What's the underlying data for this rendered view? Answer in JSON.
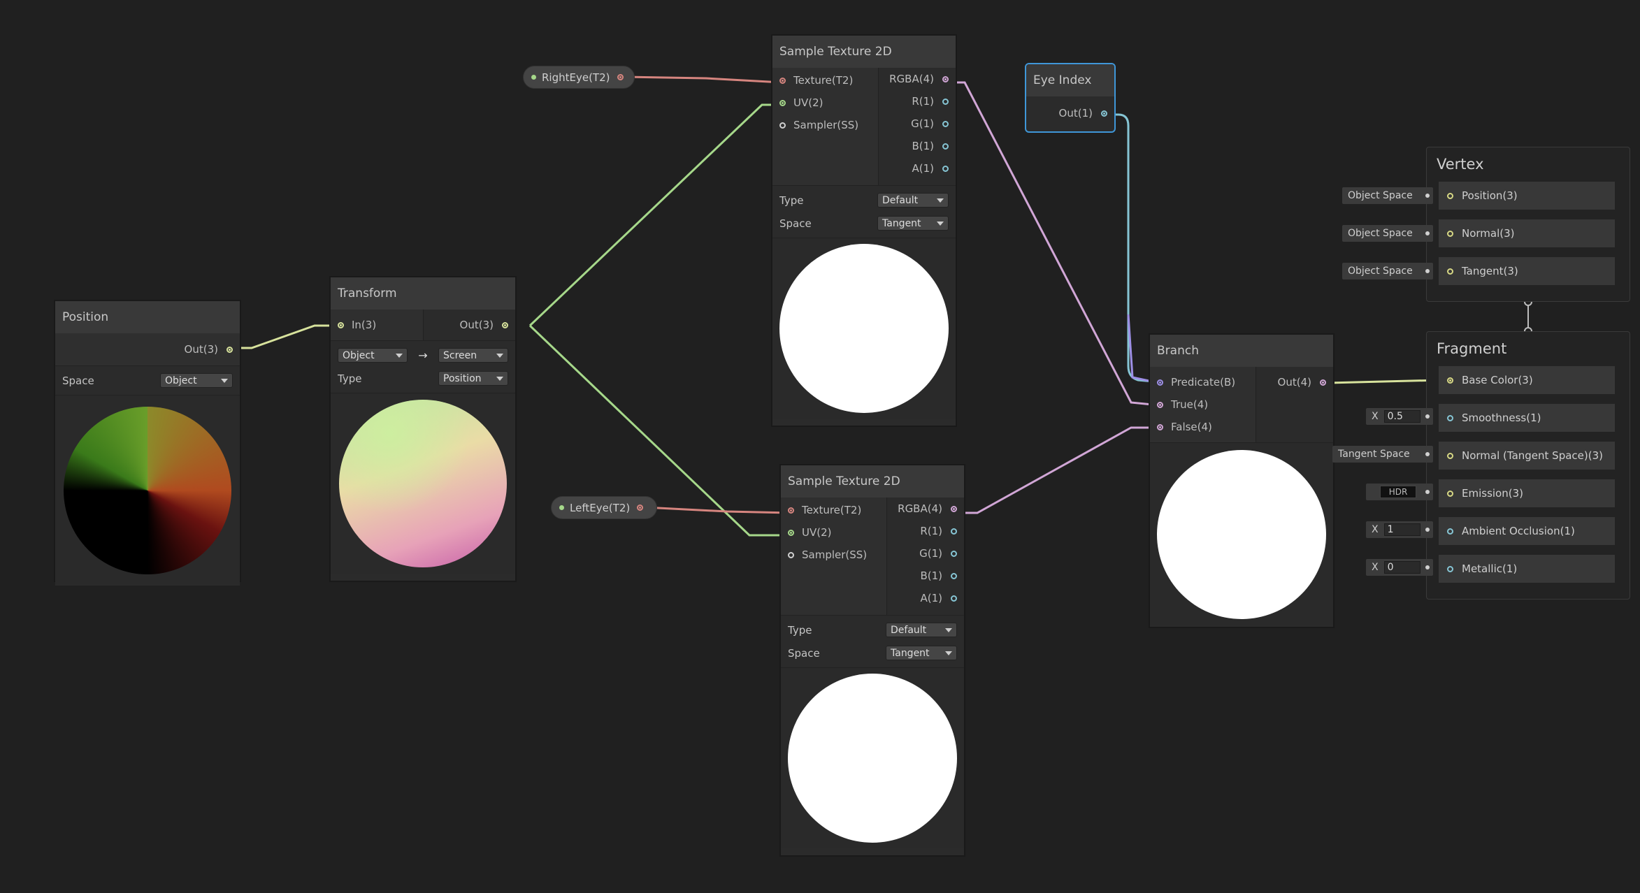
{
  "colors": {
    "background": "#202020",
    "wire_vector3": "#d7e29c",
    "wire_vector2": "#a6d88a",
    "wire_texture": "#d6857f",
    "wire_vector4": "#d1a6d6",
    "wire_float": "#86c5d4",
    "wire_boolean": "#9d8fe6",
    "selection": "#3f97d9"
  },
  "nodes": {
    "position": {
      "title": "Position",
      "out": "Out(3)",
      "space_label": "Space",
      "space_value": "Object"
    },
    "transform": {
      "title": "Transform",
      "in": "In(3)",
      "out": "Out(3)",
      "from_value": "Object",
      "arrow": "→",
      "to_value": "Screen",
      "type_label": "Type",
      "type_value": "Position"
    },
    "sample_top": {
      "title": "Sample Texture 2D",
      "inputs": [
        "Texture(T2)",
        "UV(2)",
        "Sampler(SS)"
      ],
      "outputs": [
        "RGBA(4)",
        "R(1)",
        "G(1)",
        "B(1)",
        "A(1)"
      ],
      "type_label": "Type",
      "type_value": "Default",
      "space_label": "Space",
      "space_value": "Tangent"
    },
    "sample_bottom": {
      "title": "Sample Texture 2D",
      "inputs": [
        "Texture(T2)",
        "UV(2)",
        "Sampler(SS)"
      ],
      "outputs": [
        "RGBA(4)",
        "R(1)",
        "G(1)",
        "B(1)",
        "A(1)"
      ],
      "type_label": "Type",
      "type_value": "Default",
      "space_label": "Space",
      "space_value": "Tangent"
    },
    "eye_index": {
      "title": "Eye Index",
      "out": "Out(1)"
    },
    "branch": {
      "title": "Branch",
      "inputs": [
        "Predicate(B)",
        "True(4)",
        "False(4)"
      ],
      "out": "Out(4)"
    }
  },
  "properties": {
    "right_eye": "RightEye(T2)",
    "left_eye": "LeftEye(T2)"
  },
  "vertex": {
    "title": "Vertex",
    "blocks": [
      {
        "label": "Position(3)",
        "side": "Object Space"
      },
      {
        "label": "Normal(3)",
        "side": "Object Space"
      },
      {
        "label": "Tangent(3)",
        "side": "Object Space"
      }
    ]
  },
  "fragment": {
    "title": "Fragment",
    "blocks": [
      {
        "label": "Base Color(3)"
      },
      {
        "label": "Smoothness(1)",
        "prefix": "X",
        "value": "0.5"
      },
      {
        "label": "Normal (Tangent Space)(3)",
        "side": "Tangent Space"
      },
      {
        "label": "Emission(3)",
        "hdr": "HDR"
      },
      {
        "label": "Ambient Occlusion(1)",
        "prefix": "X",
        "value": "1"
      },
      {
        "label": "Metallic(1)",
        "prefix": "X",
        "value": "0"
      }
    ]
  }
}
